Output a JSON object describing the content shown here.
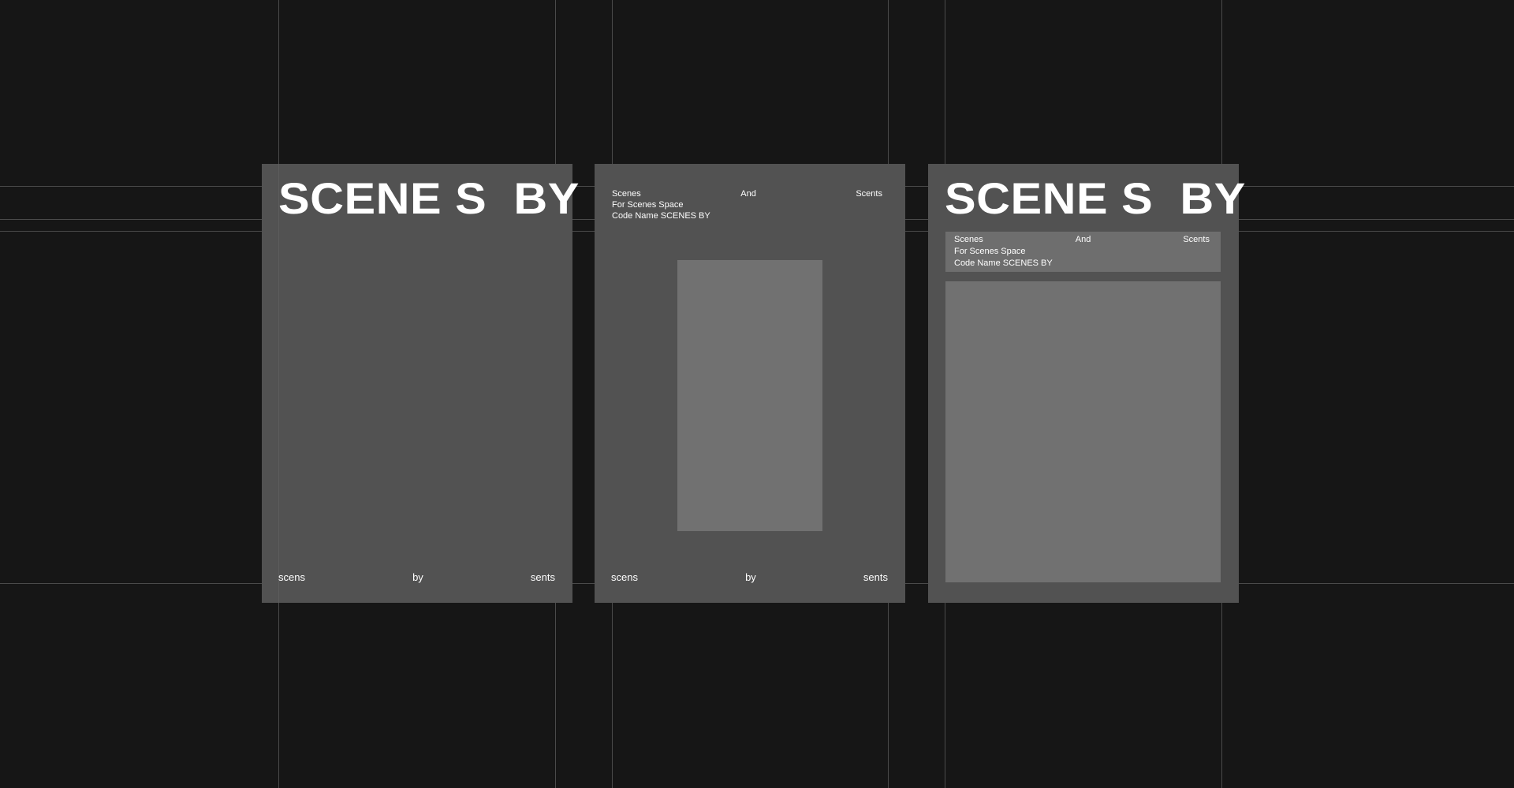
{
  "poster1": {
    "title": "SCENE S  BY",
    "footer": {
      "left": "scens",
      "center": "by",
      "right": "sents"
    }
  },
  "poster2": {
    "info": {
      "left": "Scenes",
      "center": "And",
      "right": "Scents",
      "line2": "For Scenes Space",
      "line3": "Code Name SCENES BY"
    },
    "footer": {
      "left": "scens",
      "center": "by",
      "right": "sents"
    }
  },
  "poster3": {
    "title": "SCENE S  BY",
    "info": {
      "left": "Scenes",
      "center": "And",
      "right": "Scents",
      "line2": "For Scenes Space",
      "line3": "Code Name SCENES BY"
    }
  },
  "colors": {
    "background": "#161616",
    "poster": "#525252",
    "placeholder": "#717171",
    "guide": "#4a4a4a",
    "text": "#ffffff"
  }
}
